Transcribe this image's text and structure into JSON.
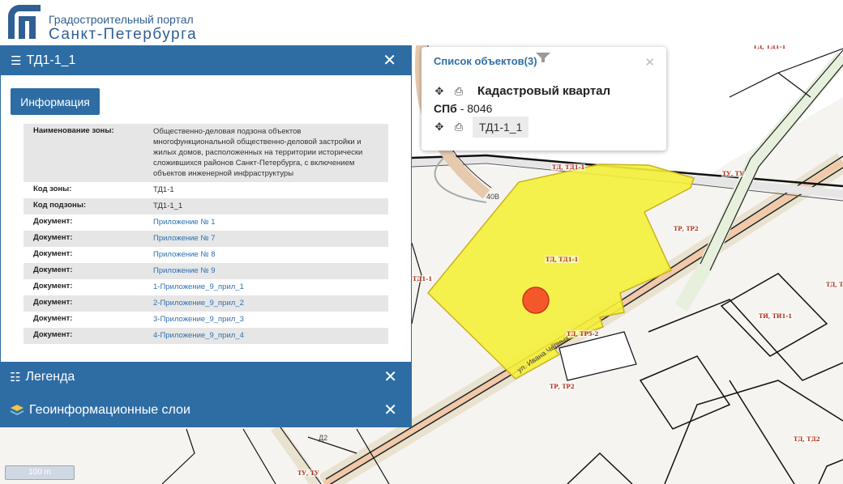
{
  "brand": {
    "line1": "Градостроительный портал",
    "line2": "Санкт-Петербурга"
  },
  "info_panel": {
    "title": "ТД1-1_1",
    "close_glyph": "✕",
    "tab_label": "Информация",
    "rows": [
      {
        "key": "Наименование зоны:",
        "value": "Общественно-деловая подзона объектов многофункциональной общественно-деловой застройки и жилых домов, расположенных на территории исторически сложившихся районов Санкт-Петербурга, с включением объектов инженерной инфраструктуры",
        "link": false
      },
      {
        "key": "Код зоны:",
        "value": "ТД1-1",
        "link": false
      },
      {
        "key": "Код подзоны:",
        "value": "ТД1-1_1",
        "link": false
      },
      {
        "key": "Документ:",
        "value": "Приложение № 1",
        "link": true
      },
      {
        "key": "Документ:",
        "value": "Приложение № 7",
        "link": true
      },
      {
        "key": "Документ:",
        "value": "Приложение № 8",
        "link": true
      },
      {
        "key": "Документ:",
        "value": "Приложение № 9",
        "link": true
      },
      {
        "key": "Документ:",
        "value": "1-Приложение_9_прил_1",
        "link": true
      },
      {
        "key": "Документ:",
        "value": "2-Приложение_9_прил_2",
        "link": true
      },
      {
        "key": "Документ:",
        "value": "3-Приложение_9_прил_3",
        "link": true
      },
      {
        "key": "Документ:",
        "value": "4-Приложение_9_прил_4",
        "link": true
      }
    ]
  },
  "legend_panel": {
    "title": "Легенда",
    "close_glyph": "✕"
  },
  "layers_panel": {
    "title": "Геоинформационные слои",
    "close_glyph": "✕"
  },
  "popup": {
    "title": "Список объектов(3)",
    "close_glyph": "✕",
    "item1_title": "Кадастровый квартал",
    "item1_code_bold": "СПб",
    "item1_code_rest": " - 8046",
    "item2_tag": "ТД1-1_1"
  },
  "map": {
    "scale_label": "100 m",
    "highlight_color": "#f5f13a",
    "marker_color": "#f4582a",
    "labels": {
      "zone_main": "ТД, ТД1-1",
      "zone_ttd": "ТД, ТД1-1",
      "tu_top": "ТУ, ТУ",
      "tr_tr2_a": "ТР, ТР2",
      "tr_tr2_b": "ТР, ТР2",
      "tr_tr5": "ТД, ТР5-2",
      "ti_ti1": "ТИ, ТИ1-1",
      "td_td2": "ТД, ТД2",
      "td_right": "ТД, ТД",
      "tu_bottom": "ТУ, ТУ",
      "td_top": "ТД, ТД1-1",
      "road_num": "40В",
      "road_name": "ул. Ивана Черных",
      "td1_left": "ТД1-1",
      "d2": "Д2"
    }
  }
}
